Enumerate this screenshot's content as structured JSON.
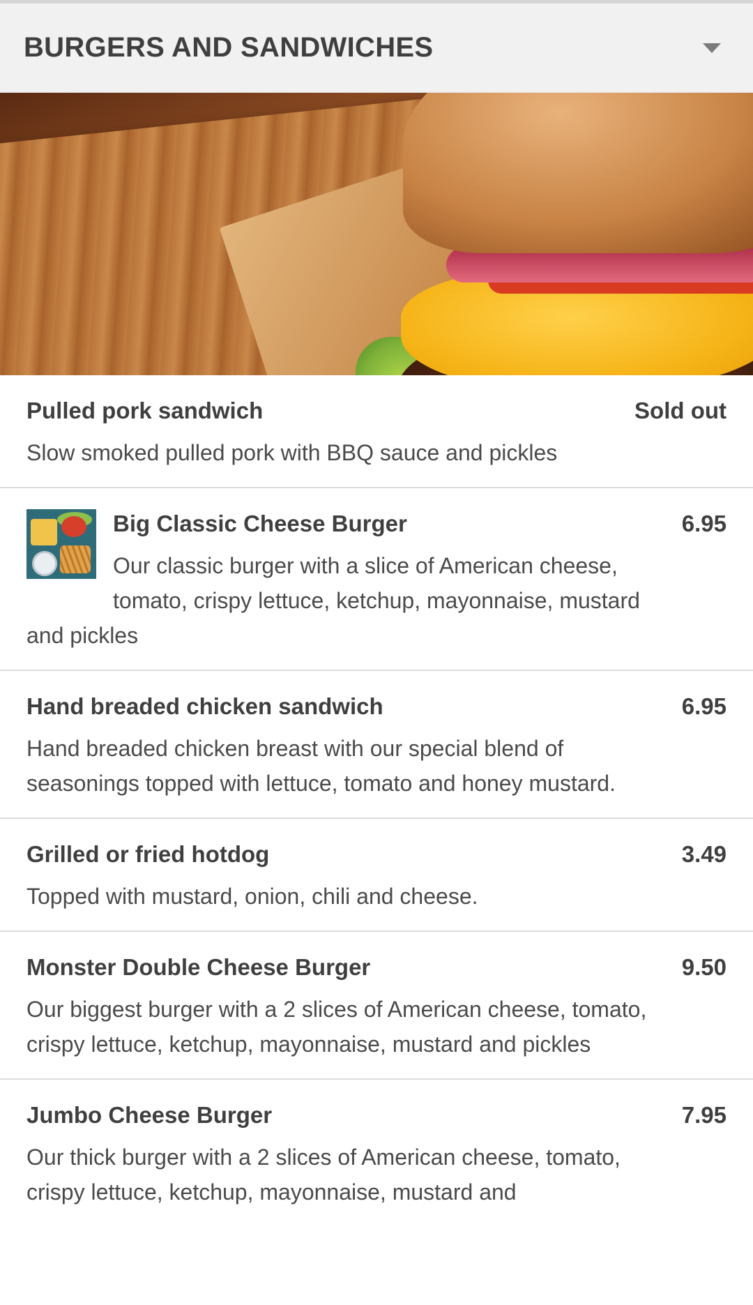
{
  "section": {
    "title": "BURGERS AND SANDWICHES",
    "toggle_icon": "caret-down-icon"
  },
  "hero": {
    "image": "cheeseburger-photo"
  },
  "items": [
    {
      "name": "Pulled pork sandwich",
      "price": "Sold out",
      "description": "Slow smoked pulled pork with BBQ sauce and pickles",
      "has_thumbnail": false
    },
    {
      "name": "Big Classic Cheese Burger",
      "price": "6.95",
      "description": "Our classic burger with a slice of American cheese, tomato, crispy lettuce, ketchup, mayonnaise, mustard and pickles",
      "has_thumbnail": true
    },
    {
      "name": "Hand breaded chicken sandwich",
      "price": "6.95",
      "description": "Hand breaded chicken breast with our special blend of seasonings topped with lettuce, tomato and honey mustard.",
      "has_thumbnail": false
    },
    {
      "name": "Grilled or fried hotdog",
      "price": "3.49",
      "description": "Topped with mustard, onion, chili and cheese.",
      "has_thumbnail": false
    },
    {
      "name": "Monster Double Cheese Burger",
      "price": "9.50",
      "description": "Our biggest burger with a 2 slices of American cheese, tomato, crispy lettuce, ketchup, mayonnaise, mustard and pickles",
      "has_thumbnail": false
    },
    {
      "name": "Jumbo Cheese Burger",
      "price": "7.95",
      "description": "Our thick burger with a 2 slices of American cheese, tomato, crispy lettuce, ketchup, mayonnaise, mustard and",
      "has_thumbnail": false
    }
  ],
  "colors": {
    "header_bg": "#f1f1f1",
    "text": "#3f3f3f",
    "divider": "#dcdcdc"
  }
}
